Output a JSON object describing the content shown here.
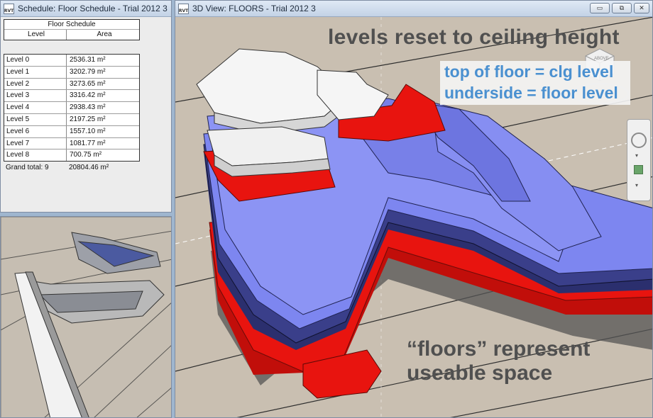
{
  "schedule_window": {
    "title": "Schedule: Floor Schedule - Trial 2012 3",
    "app_icon": "RVT",
    "table_title": "Floor Schedule",
    "col_level": "Level",
    "col_area": "Area",
    "rows": [
      {
        "level": "Level 0",
        "area": "2536.31 m²"
      },
      {
        "level": "Level 1",
        "area": "3202.79 m²"
      },
      {
        "level": "Level 2",
        "area": "3273.65 m²"
      },
      {
        "level": "Level 3",
        "area": "3316.42 m²"
      },
      {
        "level": "Level 4",
        "area": "2938.43 m²"
      },
      {
        "level": "Level 5",
        "area": "2197.25 m²"
      },
      {
        "level": "Level 6",
        "area": "1557.10 m²"
      },
      {
        "level": "Level 7",
        "area": "1081.77 m²"
      },
      {
        "level": "Level 8",
        "area": "700.75 m²"
      }
    ],
    "grand_total_label": "Grand total: 9",
    "grand_total_value": "20804.46 m²"
  },
  "view_window": {
    "title": "3D View: FLOORS - Trial 2012 3",
    "app_icon": "RVT",
    "controls": {
      "minimize": "▭",
      "restore": "⧉",
      "close": "✕"
    },
    "annotation_heading": "levels reset to ceiling height",
    "annotation_line1": "top of floor = clg level",
    "annotation_line2": "underside = floor level",
    "annotation_floors_1": "“floors” represent",
    "annotation_floors_2": "useable space",
    "viewcube_label": "ABOVE",
    "colors": {
      "floor_red": "#e8140f",
      "floor_blue": "#7d86f0",
      "floor_white": "#f4f4f4",
      "annotation_blue": "#4a90d0",
      "annotation_gray": "#505050",
      "ground": "#c8beb0"
    },
    "icons": [
      "viewcube-icon",
      "steering-wheel-icon",
      "pan-icon"
    ]
  }
}
